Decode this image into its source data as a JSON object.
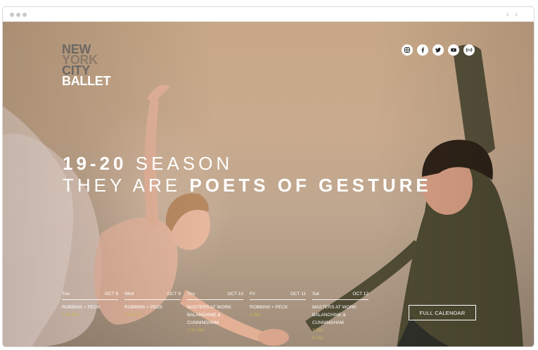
{
  "browser": {
    "nav_prev": "‹",
    "nav_next": "›"
  },
  "logo": {
    "line1": "NEW",
    "line2": "YORK",
    "line3": "CITY",
    "line4": "BALLET"
  },
  "social": [
    {
      "icon": "instagram-icon"
    },
    {
      "icon": "facebook-icon"
    },
    {
      "icon": "twitter-icon"
    },
    {
      "icon": "youtube-icon"
    },
    {
      "icon": "podcast-icon"
    }
  ],
  "headline": {
    "season_bold": "19-20",
    "season_light": "SEASON",
    "tagline_light": "THEY ARE",
    "tagline_bold": "POETS OF GESTURE"
  },
  "events": [
    {
      "day": "Tue",
      "date": "OCT 8",
      "title": "ROBBINS + PECK",
      "time": "7:30 PM"
    },
    {
      "day": "Wed",
      "date": "OCT 9",
      "title": "ROBBINS + PECK",
      "time": "7:30 PM"
    },
    {
      "day": "Thu",
      "date": "OCT 10",
      "title": "MASTERS AT WORK: BALANCHINE & CUNNINGHAM",
      "time": "7:30 PM"
    },
    {
      "day": "Fri",
      "date": "OCT 11",
      "title": "ROBBINS + PECK",
      "time": "8 PM"
    },
    {
      "day": "Sat",
      "date": "OCT 12",
      "title": "MASTERS AT WORK: BALANCHINE & CUNNINGHAM",
      "time": "2 PM"
    }
  ],
  "events_extra_time": "8 PM",
  "full_calendar_label": "FULL CALENDAR",
  "colors": {
    "time_accent": "#c7b45a",
    "background": "#c9aa8d"
  }
}
